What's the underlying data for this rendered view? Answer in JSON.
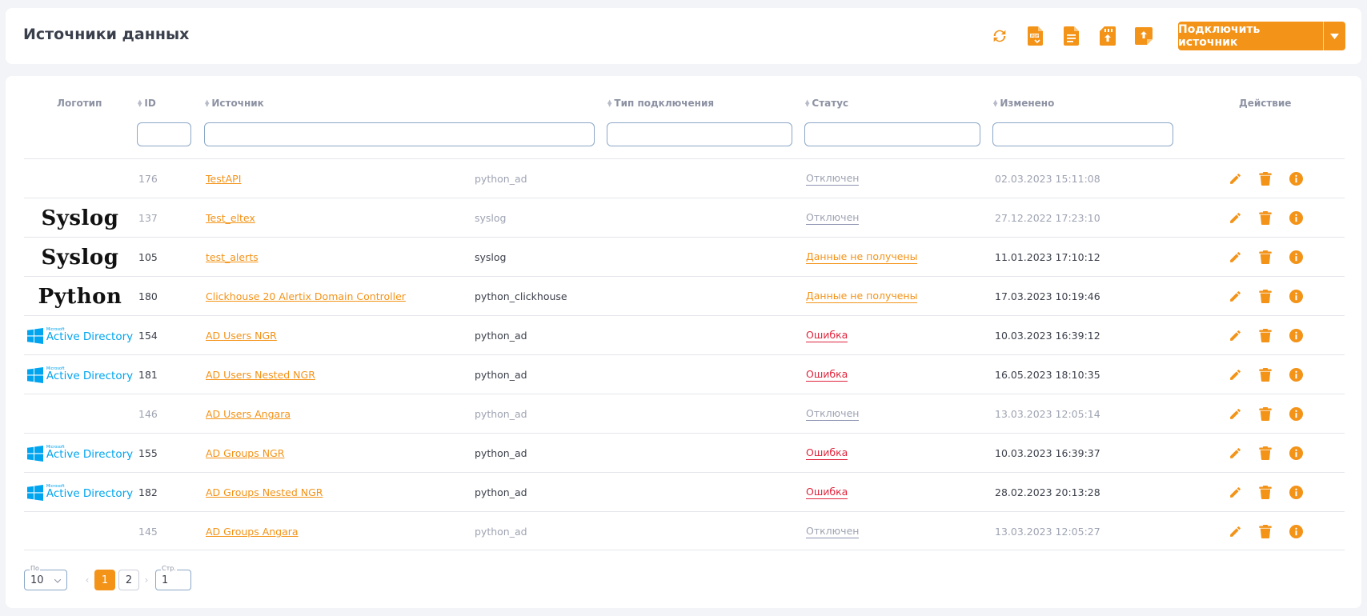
{
  "header": {
    "title": "Источники данных",
    "toolbar_icons": [
      "refresh-icon",
      "pdf-export-icon",
      "document-icon",
      "sd-upload-icon",
      "note-upload-icon"
    ],
    "connect_button": "Подключить источник"
  },
  "table": {
    "columns": {
      "logo": "Логотип",
      "id": "ID",
      "source": "Источник",
      "type": "Тип подключения",
      "status": "Статус",
      "changed": "Изменено",
      "action": "Действие"
    },
    "rows": [
      {
        "logo": "",
        "id": "176",
        "source": "TestAPI",
        "type": "python_ad",
        "status": "Отключен",
        "status_kind": "off",
        "changed": "02.03.2023 15:11:08"
      },
      {
        "logo": "Syslog",
        "id": "137",
        "source": "Test_eltex",
        "type": "syslog",
        "status": "Отключен",
        "status_kind": "off",
        "changed": "27.12.2022 17:23:10"
      },
      {
        "logo": "Syslog",
        "id": "105",
        "source": "test_alerts",
        "type": "syslog",
        "status": "Данные не получены",
        "status_kind": "nodata",
        "changed": "11.01.2023 17:10:12"
      },
      {
        "logo": "Python",
        "id": "180",
        "source": "Clickhouse 20 Alertix Domain Controller",
        "type": "python_clickhouse",
        "status": "Данные не получены",
        "status_kind": "nodata",
        "changed": "17.03.2023 10:19:46"
      },
      {
        "logo": "Active Directory",
        "id": "154",
        "source": "AD Users NGR",
        "type": "python_ad",
        "status": "Ошибка",
        "status_kind": "error",
        "changed": "10.03.2023 16:39:12"
      },
      {
        "logo": "Active Directory",
        "id": "181",
        "source": "AD Users Nested NGR",
        "type": "python_ad",
        "status": "Ошибка",
        "status_kind": "error",
        "changed": "16.05.2023 18:10:35"
      },
      {
        "logo": "",
        "id": "146",
        "source": "AD Users Angara",
        "type": "python_ad",
        "status": "Отключен",
        "status_kind": "off",
        "changed": "13.03.2023 12:05:14"
      },
      {
        "logo": "Active Directory",
        "id": "155",
        "source": "AD Groups NGR",
        "type": "python_ad",
        "status": "Ошибка",
        "status_kind": "error",
        "changed": "10.03.2023 16:39:37"
      },
      {
        "logo": "Active Directory",
        "id": "182",
        "source": "AD Groups Nested NGR",
        "type": "python_ad",
        "status": "Ошибка",
        "status_kind": "error",
        "changed": "28.02.2023 20:13:28"
      },
      {
        "logo": "",
        "id": "145",
        "source": "AD Groups Angara",
        "type": "python_ad",
        "status": "Отключен",
        "status_kind": "off",
        "changed": "13.03.2023 12:05:27"
      }
    ]
  },
  "pagination": {
    "per_page_label": "По",
    "per_page": "10",
    "pages": [
      "1",
      "2"
    ],
    "current_page": "1",
    "goto_label": "Стр.",
    "goto_value": "1"
  },
  "colors": {
    "accent": "#f39318",
    "error": "#e0253d",
    "ad_blue": "#00a4ef"
  }
}
